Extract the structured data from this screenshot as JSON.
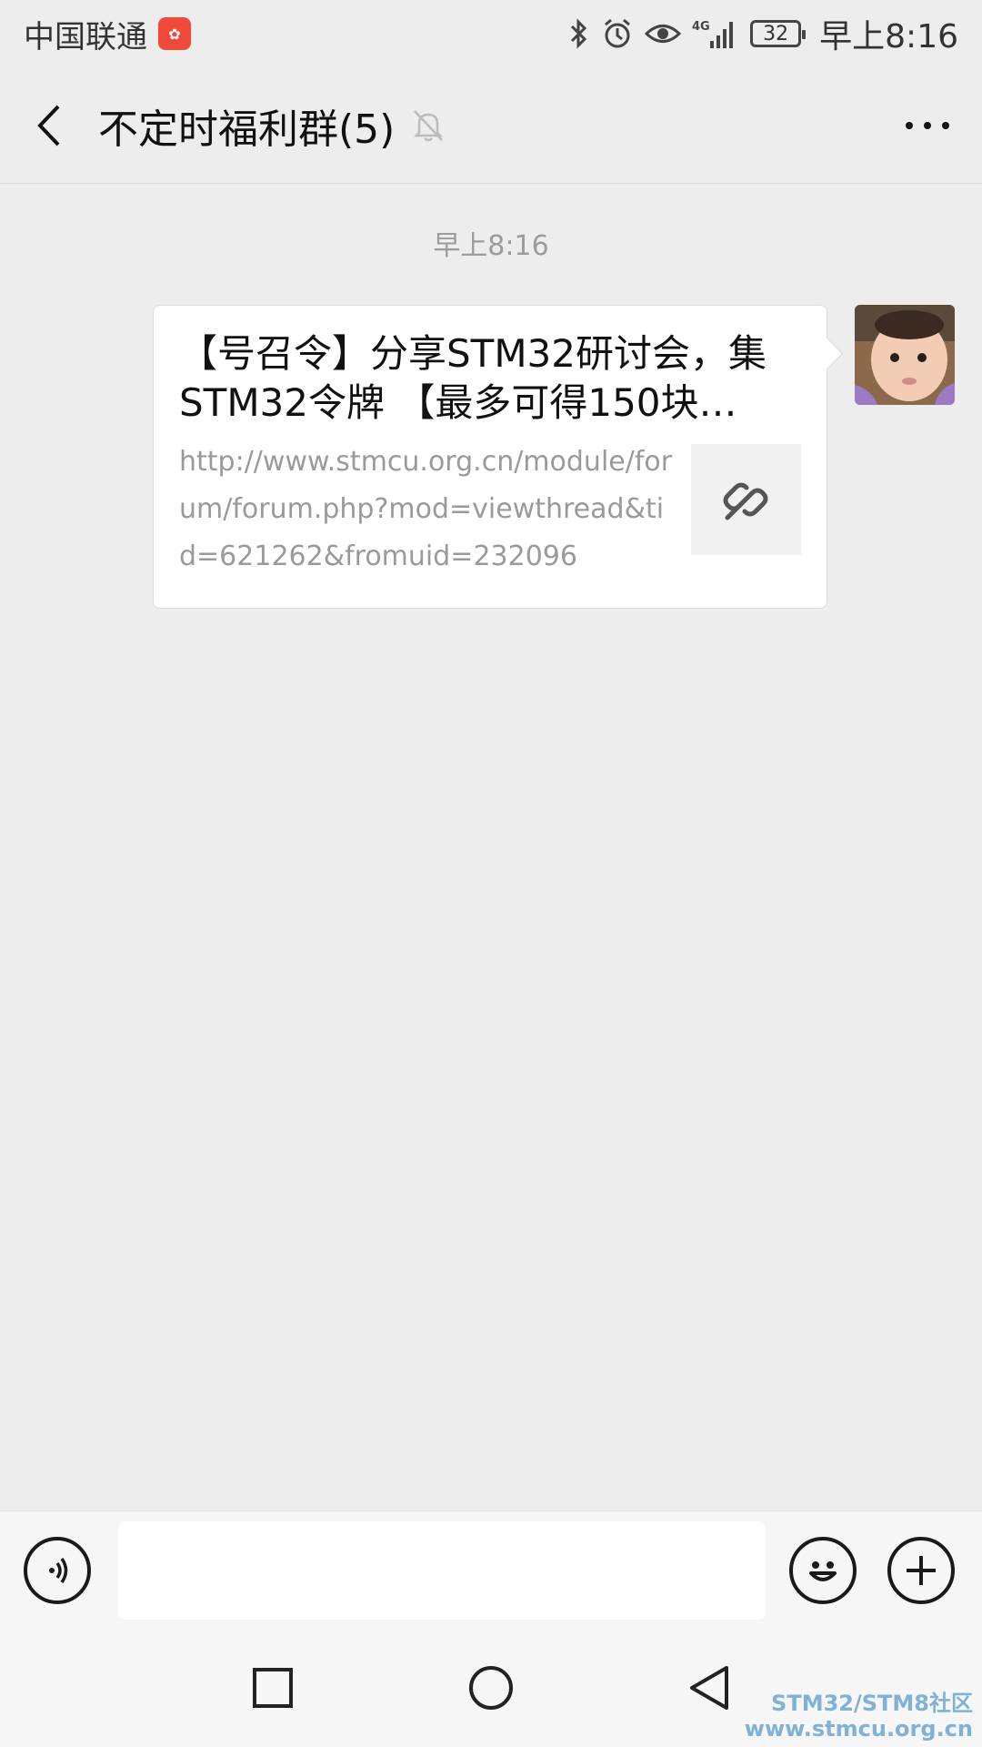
{
  "status_bar": {
    "carrier": "中国联通",
    "network": "4G",
    "battery": "32",
    "time": "早上8:16"
  },
  "header": {
    "title": "不定时福利群(5)"
  },
  "chat": {
    "timestamp": "早上8:16",
    "message": {
      "title": "【号召令】分享STM32研讨会，集STM32令牌 【最多可得150块…",
      "url": "http://www.stmcu.org.cn/module/forum/forum.php?mod=viewthread&tid=621262&fromuid=232096"
    }
  },
  "input": {
    "placeholder": ""
  },
  "watermark": {
    "line1": "STM32/STM8社区",
    "line2": "www.stmcu.org.cn"
  },
  "colors": {
    "background": "#ededed",
    "bubble": "#ffffff",
    "meta_text": "#9b9b9b",
    "watermark": "#7fb2d6"
  },
  "icons": [
    "bluetooth-icon",
    "alarm-icon",
    "eye-icon",
    "signal-icon",
    "battery-icon",
    "back-icon",
    "mute-icon",
    "more-icon",
    "link-icon",
    "voice-icon",
    "emoji-icon",
    "plus-icon",
    "square-nav-icon",
    "circle-nav-icon",
    "triangle-nav-icon"
  ]
}
